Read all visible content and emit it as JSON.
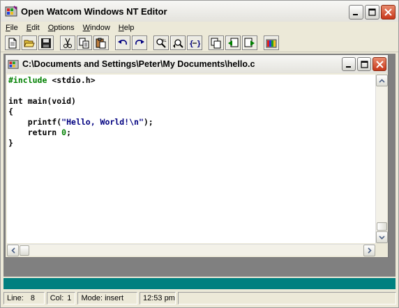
{
  "window": {
    "title": "Open Watcom Windows NT Editor"
  },
  "menu": [
    {
      "label": "File",
      "mnemonic": "F",
      "rest": "ile"
    },
    {
      "label": "Edit",
      "mnemonic": "E",
      "rest": "dit"
    },
    {
      "label": "Options",
      "mnemonic": "O",
      "rest": "ptions"
    },
    {
      "label": "Window",
      "mnemonic": "W",
      "rest": "indow"
    },
    {
      "label": "Help",
      "mnemonic": "H",
      "rest": "elp"
    }
  ],
  "toolbar": {
    "buttons": [
      {
        "name": "new-file-icon"
      },
      {
        "name": "open-folder-icon"
      },
      {
        "name": "save-disk-icon"
      },
      {
        "name": "cut-scissors-icon"
      },
      {
        "name": "copy-icon"
      },
      {
        "name": "paste-icon"
      },
      {
        "name": "undo-icon"
      },
      {
        "name": "redo-icon"
      },
      {
        "name": "find-icon"
      },
      {
        "name": "find-next-icon"
      },
      {
        "name": "match-brace-icon"
      },
      {
        "name": "new-window-icon"
      },
      {
        "name": "previous-window-icon"
      },
      {
        "name": "next-window-icon"
      },
      {
        "name": "watcom-logo-icon"
      }
    ]
  },
  "document": {
    "title": "C:\\Documents and Settings\\Peter\\My Documents\\hello.c",
    "lines": {
      "l1_pp": "#include",
      "l1_rest": " <stdio.h>",
      "l2": "",
      "l3": "int main(void)",
      "l4": "{",
      "l5_pre": "    printf(",
      "l5_str": "\"Hello, World!\\n\"",
      "l5_post": ");",
      "l6_pre": "    return ",
      "l6_num": "0",
      "l6_post": ";",
      "l7": "}"
    }
  },
  "status": {
    "line_label": "Line:",
    "line_value": "8",
    "col_label": "Col:",
    "col_value": "1",
    "mode": "Mode: insert",
    "time": "12:53 pm"
  },
  "colors": {
    "mdi_background": "#808080",
    "teal_strip": "#008080",
    "preprocessor": "#008000",
    "string": "#000080",
    "number": "#008000"
  }
}
